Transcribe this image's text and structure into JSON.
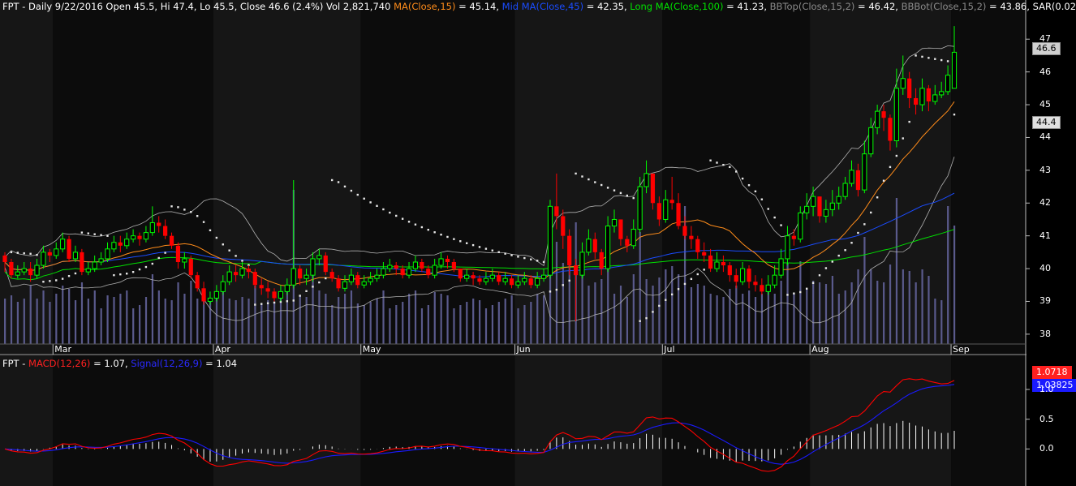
{
  "header": {
    "symbol": "FPT",
    "info": " - Daily 9/22/2016 Open 45.5, Hi 47.4, Lo 45.5, Close 46.6 (2.4%) Vol 2,821,740 ",
    "ma_label": "MA(Close,15)",
    "ma_value": " = 45.14, ",
    "mid_label": "Mid MA(Close,45)",
    "mid_value": " = 42.35, ",
    "long_label": "Long MA(Close,100)",
    "long_value": " = 41.23, ",
    "bbtop_label": "BBTop(Close,15,2)",
    "bbtop_value": " = 46.42, ",
    "bbbot_label": "BBBot(Close,15,2)",
    "bbbot_value": " = 43.86, ",
    "sar_label": "SAR(0.02,0"
  },
  "macd_header": {
    "symbol": "FPT",
    "sep": " - ",
    "macd_label": "MACD(12,26)",
    "macd_value": " = 1.07, ",
    "signal_label": "Signal(12,26,9)",
    "signal_value": " = 1.04"
  },
  "price_tags": {
    "close": "46.6",
    "level": "44.4",
    "macd": "1.0718",
    "signal": "1.03825"
  },
  "price_axis": [
    "47",
    "46",
    "45",
    "44",
    "43",
    "42",
    "41",
    "40",
    "39",
    "38"
  ],
  "macd_axis": [
    "1.0",
    "0.5",
    "0.0"
  ],
  "months": [
    "Mar",
    "Apr",
    "May",
    "Jun",
    "Jul",
    "Aug",
    "Sep"
  ],
  "colors": {
    "up": "#00ff00",
    "down": "#ff0000",
    "ma15": "#ff8c1a",
    "ma45": "#1a4cff",
    "ma100": "#00e000",
    "bands": "#b0b0b0",
    "sar": "#e8e8e8",
    "volume": "#5a5a8c",
    "macd": "#ff0000",
    "signal": "#1a1aff",
    "hist": "#ffffff"
  },
  "chart_data": {
    "type": "candlestick",
    "symbol": "FPT",
    "ylim": [
      37.7,
      47.6
    ],
    "macd_ylim": [
      -0.5,
      1.3
    ],
    "grid": false,
    "closes": [
      40.2,
      39.8,
      39.9,
      40.0,
      39.8,
      40.1,
      40.5,
      40.4,
      40.6,
      40.9,
      40.3,
      40.5,
      39.9,
      40.0,
      40.2,
      40.3,
      40.6,
      40.8,
      40.7,
      40.9,
      41.0,
      40.9,
      41.1,
      41.4,
      41.3,
      41.0,
      40.7,
      40.2,
      40.3,
      39.8,
      39.4,
      39.0,
      39.1,
      39.3,
      39.6,
      39.9,
      39.8,
      40.0,
      39.9,
      39.5,
      39.4,
      39.3,
      39.1,
      39.3,
      39.5,
      40.0,
      39.7,
      39.8,
      40.3,
      40.4,
      39.9,
      39.7,
      39.4,
      39.6,
      39.8,
      39.5,
      39.6,
      39.7,
      39.8,
      40.0,
      40.1,
      40.0,
      39.8,
      40.0,
      40.2,
      40.0,
      39.8,
      40.1,
      40.3,
      40.2,
      40.0,
      39.7,
      39.8,
      39.7,
      39.6,
      39.7,
      39.8,
      39.6,
      39.7,
      39.5,
      39.6,
      39.7,
      39.5,
      39.7,
      39.8,
      41.9,
      41.6,
      41.0,
      40.1,
      39.8,
      40.5,
      40.9,
      40.5,
      40.0,
      41.3,
      41.5,
      40.9,
      40.7,
      41.2,
      42.5,
      42.9,
      42.0,
      41.5,
      42.1,
      42.0,
      41.3,
      41.0,
      40.9,
      40.5,
      40.4,
      40.0,
      40.2,
      40.1,
      39.8,
      39.6,
      40.0,
      39.6,
      39.5,
      39.3,
      39.5,
      39.8,
      40.3,
      41.0,
      40.9,
      41.7,
      41.9,
      42.2,
      41.6,
      41.8,
      42.0,
      42.2,
      42.6,
      43.0,
      42.4,
      43.5,
      44.3,
      44.8,
      44.6,
      43.9,
      45.5,
      45.8,
      45.2,
      45.0,
      45.5,
      45.1,
      45.3,
      45.4,
      45.9,
      46.6
    ],
    "opens": [
      40.4,
      40.2,
      39.8,
      39.9,
      40.0,
      39.8,
      40.1,
      40.5,
      40.4,
      40.6,
      40.9,
      40.3,
      40.5,
      39.9,
      40.0,
      40.2,
      40.3,
      40.6,
      40.8,
      40.7,
      40.9,
      41.0,
      40.9,
      41.1,
      41.4,
      41.3,
      41.0,
      40.7,
      40.2,
      40.3,
      39.8,
      39.4,
      39.0,
      39.1,
      39.3,
      39.6,
      39.9,
      39.8,
      40.0,
      39.9,
      39.5,
      39.4,
      39.3,
      39.1,
      39.3,
      39.5,
      40.0,
      39.7,
      39.8,
      40.3,
      40.4,
      39.9,
      39.7,
      39.4,
      39.6,
      39.8,
      39.5,
      39.6,
      39.7,
      39.8,
      40.0,
      40.1,
      40.0,
      39.8,
      40.0,
      40.2,
      40.0,
      39.8,
      40.1,
      40.3,
      40.2,
      40.0,
      39.7,
      39.8,
      39.7,
      39.6,
      39.7,
      39.8,
      39.6,
      39.7,
      39.5,
      39.6,
      39.7,
      39.5,
      39.7,
      39.8,
      41.9,
      41.6,
      41.0,
      40.1,
      39.8,
      40.5,
      40.9,
      40.5,
      40.0,
      41.3,
      41.5,
      40.9,
      40.7,
      41.2,
      42.5,
      42.9,
      42.0,
      41.5,
      42.1,
      42.0,
      41.3,
      41.0,
      40.9,
      40.5,
      40.4,
      40.0,
      40.2,
      40.1,
      39.8,
      39.6,
      40.0,
      39.6,
      39.5,
      39.3,
      39.5,
      39.8,
      40.3,
      41.0,
      40.9,
      41.7,
      41.9,
      42.2,
      41.6,
      41.8,
      42.0,
      42.2,
      42.6,
      43.0,
      42.4,
      43.5,
      44.3,
      44.8,
      44.6,
      43.9,
      45.5,
      45.8,
      45.2,
      45.0,
      45.5,
      45.1,
      45.3,
      45.4,
      45.5
    ],
    "highs": [
      40.5,
      40.3,
      40.1,
      40.2,
      40.2,
      40.3,
      40.7,
      40.6,
      40.8,
      41.1,
      41.0,
      40.7,
      40.6,
      40.2,
      40.4,
      40.5,
      40.8,
      41.0,
      41.0,
      41.1,
      41.2,
      41.1,
      41.3,
      41.9,
      41.6,
      41.5,
      41.1,
      40.8,
      40.5,
      40.4,
      39.9,
      39.6,
      39.3,
      39.5,
      39.8,
      40.1,
      40.1,
      40.2,
      40.1,
      40.0,
      39.7,
      39.6,
      39.4,
      39.5,
      39.7,
      42.7,
      40.1,
      40.0,
      40.5,
      40.6,
      40.5,
      40.0,
      39.8,
      39.8,
      40.0,
      39.9,
      39.8,
      39.9,
      40.0,
      40.2,
      40.3,
      40.2,
      40.1,
      40.2,
      40.4,
      40.3,
      40.1,
      40.3,
      40.5,
      40.4,
      40.3,
      40.0,
      40.0,
      39.9,
      39.8,
      39.9,
      40.0,
      39.9,
      39.9,
      39.8,
      39.8,
      39.9,
      39.8,
      39.9,
      40.0,
      42.1,
      42.9,
      41.8,
      41.2,
      40.3,
      40.8,
      41.2,
      41.1,
      40.6,
      41.6,
      41.8,
      41.5,
      41.0,
      41.5,
      42.8,
      43.3,
      42.6,
      42.2,
      42.4,
      42.8,
      42.3,
      41.6,
      41.3,
      41.0,
      40.8,
      40.6,
      40.5,
      40.4,
      40.2,
      40.0,
      40.2,
      40.1,
      39.8,
      39.7,
      39.8,
      40.1,
      40.6,
      41.3,
      41.2,
      41.9,
      42.3,
      42.5,
      42.2,
      42.1,
      42.4,
      42.5,
      42.8,
      43.3,
      43.2,
      43.9,
      44.6,
      45.0,
      45.0,
      44.7,
      46.1,
      46.5,
      46.0,
      45.5,
      45.8,
      45.6,
      45.6,
      45.7,
      46.2,
      47.4
    ],
    "lows": [
      39.9,
      39.7,
      39.7,
      39.8,
      39.6,
      39.7,
      40.0,
      40.2,
      40.3,
      40.5,
      40.2,
      40.2,
      39.8,
      39.8,
      39.9,
      40.1,
      40.2,
      40.5,
      40.5,
      40.6,
      40.8,
      40.7,
      40.8,
      41.0,
      41.1,
      40.9,
      40.6,
      40.0,
      40.0,
      39.7,
      39.3,
      38.9,
      38.9,
      39.0,
      39.2,
      39.5,
      39.6,
      39.7,
      39.7,
      39.4,
      39.2,
      39.1,
      39.0,
      39.0,
      39.2,
      39.4,
      39.5,
      39.5,
      39.6,
      40.1,
      39.8,
      39.6,
      39.3,
      39.3,
      39.5,
      39.4,
      39.4,
      39.5,
      39.6,
      39.7,
      39.9,
      39.8,
      39.7,
      39.7,
      39.9,
      39.9,
      39.7,
      39.7,
      40.0,
      40.0,
      39.9,
      39.6,
      39.6,
      39.5,
      39.5,
      39.5,
      39.6,
      39.5,
      39.5,
      39.4,
      39.4,
      39.5,
      39.4,
      39.4,
      39.6,
      39.7,
      41.2,
      40.6,
      39.8,
      38.4,
      39.7,
      40.4,
      40.3,
      39.8,
      39.9,
      41.1,
      40.7,
      40.5,
      40.6,
      41.1,
      42.3,
      41.8,
      41.3,
      41.4,
      41.8,
      41.2,
      40.9,
      40.6,
      40.3,
      40.2,
      39.9,
      39.9,
      39.9,
      39.6,
      39.4,
      39.5,
      39.4,
      39.3,
      39.2,
      39.2,
      39.4,
      39.7,
      40.1,
      40.7,
      40.8,
      41.5,
      41.6,
      41.4,
      41.4,
      41.6,
      41.8,
      42.1,
      42.5,
      42.2,
      42.3,
      43.4,
      44.1,
      44.2,
      43.6,
      43.7,
      45.3,
      44.9,
      44.7,
      44.8,
      44.8,
      45.0,
      45.2,
      45.3,
      45.5
    ]
  }
}
